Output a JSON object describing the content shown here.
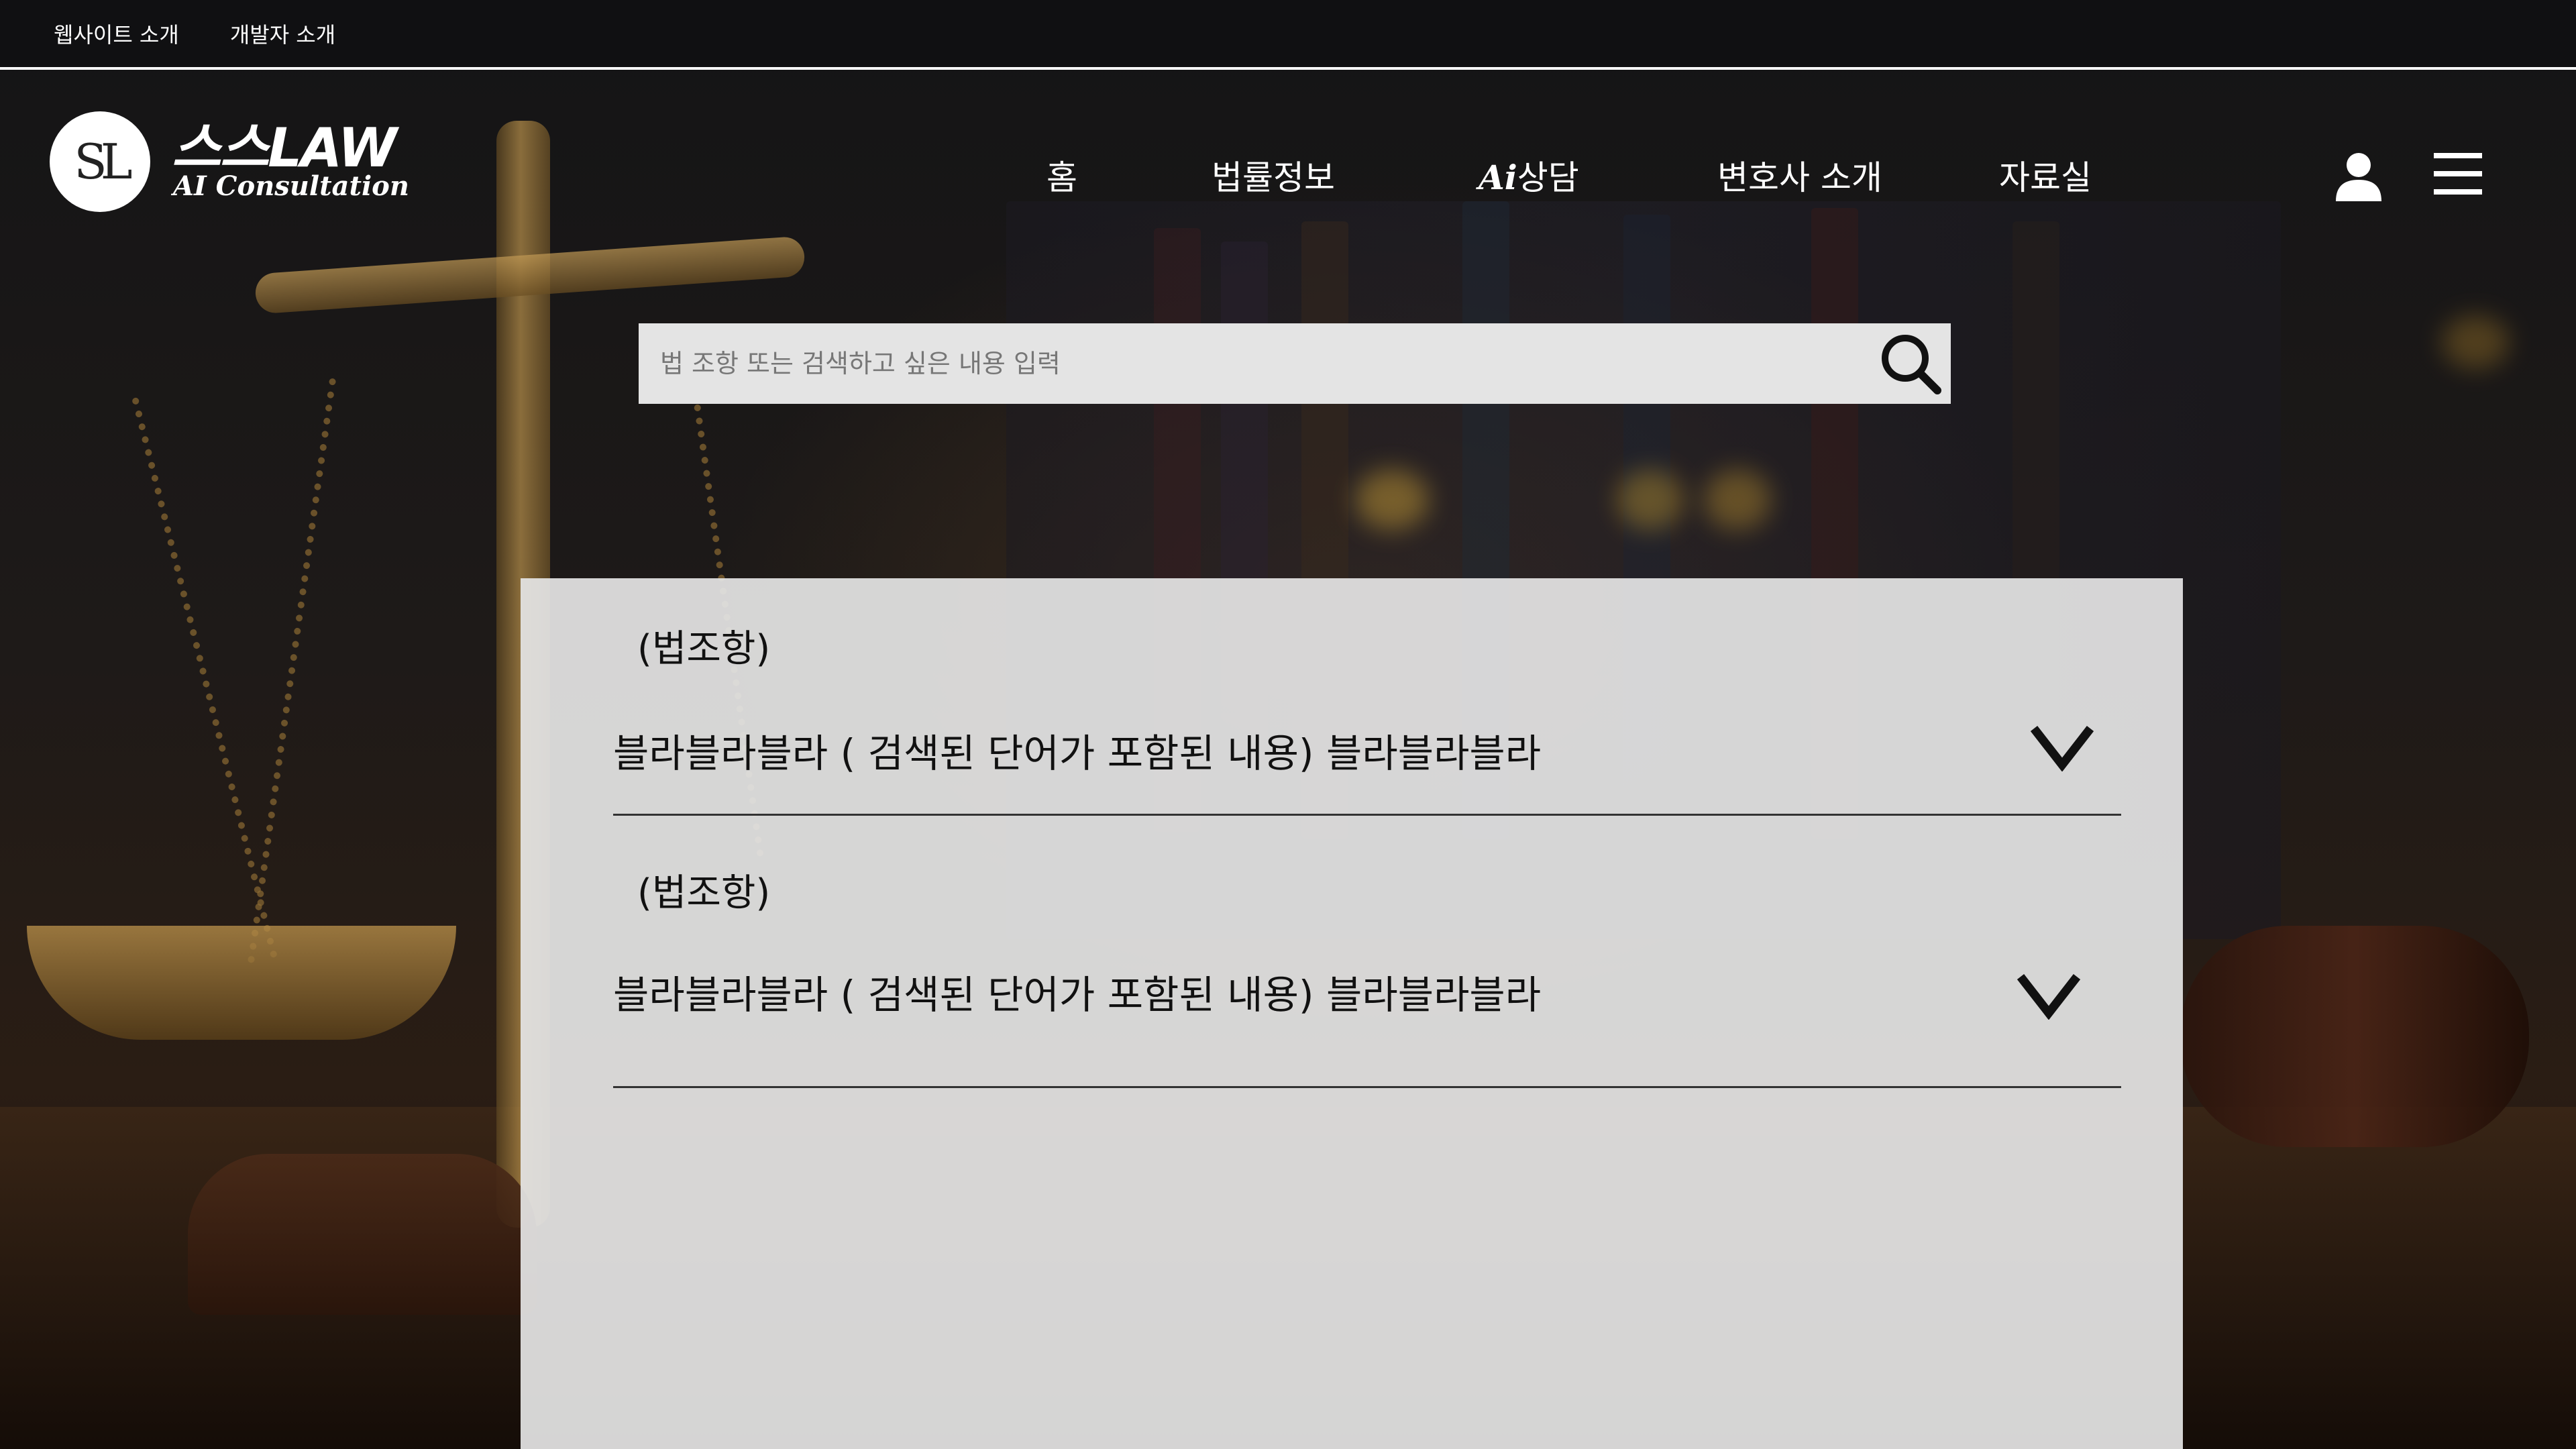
{
  "topbar": {
    "links": [
      "웹사이트 소개",
      "개발자 소개"
    ]
  },
  "brand": {
    "logo_text": "SL",
    "title": "스스LAW",
    "subtitle": "AI Consultation"
  },
  "nav": {
    "items": [
      {
        "label": "홈"
      },
      {
        "label": "법률정보"
      },
      {
        "prefix": "Ai",
        "label": "상담"
      },
      {
        "label": "변호사 소개"
      },
      {
        "label": "자료실"
      }
    ]
  },
  "header_icons": [
    "user-icon",
    "hamburger-menu-icon"
  ],
  "search": {
    "placeholder": "법 조항 또는 검색하고 싶은 내용 입력",
    "value": "",
    "icon": "search-icon"
  },
  "results": [
    {
      "law": "(법조항)",
      "content": "블라블라블라 ( 검색된 단어가 포함된 내용) 블라블라블라",
      "toggle_icon": "chevron-down-icon"
    },
    {
      "law": "(법조항)",
      "content": "블라블라블라 ( 검색된 단어가 포함된 내용) 블라블라블라",
      "toggle_icon": "chevron-down-icon"
    }
  ],
  "colors": {
    "topbar_border": "#ffffff",
    "search_bg": "#e4e4e4",
    "panel_bg": "#e4e4e4",
    "text_dark": "#111111",
    "text_light": "#ffffff"
  }
}
